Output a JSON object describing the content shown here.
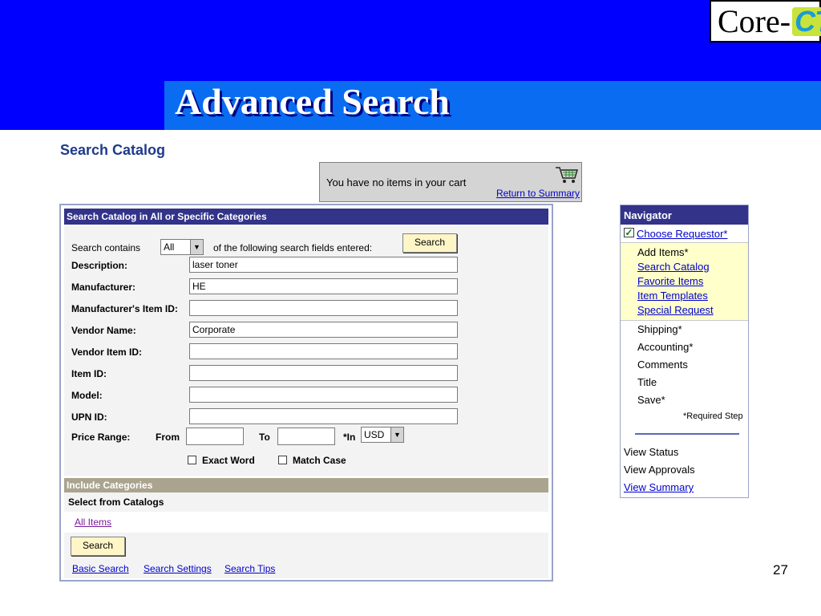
{
  "slide": {
    "title": "Advanced Search",
    "page_number": "27",
    "logo": {
      "left": "Core",
      "dash": "-",
      "right": "CT"
    }
  },
  "page_heading": "Search Catalog",
  "cart": {
    "message": "You have no items in your cart",
    "return_link": "Return to Summary"
  },
  "search_panel": {
    "header": "Search Catalog in All or Specific Categories",
    "contains_label": "Search contains",
    "contains_value": "All",
    "following_label": "of the following search fields entered:",
    "search_button": "Search",
    "fields": {
      "description": {
        "label": "Description:",
        "value": "laser toner"
      },
      "manufacturer": {
        "label": "Manufacturer:",
        "value": "HE"
      },
      "manufacturer_item_id": {
        "label": "Manufacturer's Item ID:",
        "value": ""
      },
      "vendor_name": {
        "label": "Vendor Name:",
        "value": "Corporate"
      },
      "vendor_item_id": {
        "label": "Vendor Item ID:",
        "value": ""
      },
      "item_id": {
        "label": "Item ID:",
        "value": ""
      },
      "model": {
        "label": "Model:",
        "value": ""
      },
      "upn_id": {
        "label": "UPN ID:",
        "value": ""
      }
    },
    "price_range": {
      "label": "Price Range:",
      "from_label": "From",
      "to_label": "To",
      "in_label": "*In",
      "currency": "USD"
    },
    "options": {
      "exact_word": "Exact Word",
      "match_case": "Match Case"
    },
    "categories": {
      "header": "Include Categories",
      "select_label": "Select from Catalogs",
      "item": "All Items"
    },
    "bottom_search_button": "Search",
    "links": {
      "basic_search": "Basic Search",
      "search_settings": "Search Settings",
      "search_tips": "Search Tips"
    }
  },
  "navigator": {
    "header": "Navigator",
    "choose_requestor": "Choose Requestor*",
    "add_items": "Add Items*",
    "search_catalog": "Search Catalog",
    "favorite_items": "Favorite Items",
    "item_templates": "Item Templates",
    "special_request": "Special Request",
    "shipping": "Shipping*",
    "accounting": "Accounting*",
    "comments": "Comments",
    "title": "Title",
    "save": "Save*",
    "required_step": "*Required Step",
    "view_status": "View Status",
    "view_approvals": "View Approvals",
    "view_summary": "View Summary"
  },
  "colors": {
    "slide_blue": "#0000ff",
    "title_band": "#0a6cf0",
    "panel_header": "#33338a",
    "category_header": "#aaa48f",
    "button_fill": "#fff6c8",
    "nav_highlight": "#ffffcc",
    "link": "#0000cc"
  }
}
